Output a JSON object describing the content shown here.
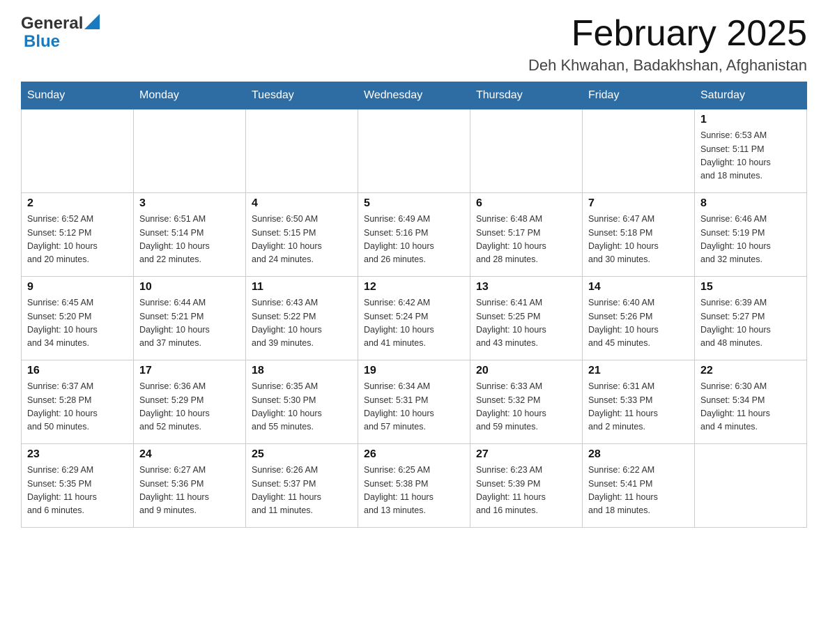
{
  "header": {
    "logo_general": "General",
    "logo_blue": "Blue",
    "month_title": "February 2025",
    "location": "Deh Khwahan, Badakhshan, Afghanistan"
  },
  "weekdays": [
    "Sunday",
    "Monday",
    "Tuesday",
    "Wednesday",
    "Thursday",
    "Friday",
    "Saturday"
  ],
  "weeks": [
    [
      {
        "day": "",
        "info": ""
      },
      {
        "day": "",
        "info": ""
      },
      {
        "day": "",
        "info": ""
      },
      {
        "day": "",
        "info": ""
      },
      {
        "day": "",
        "info": ""
      },
      {
        "day": "",
        "info": ""
      },
      {
        "day": "1",
        "info": "Sunrise: 6:53 AM\nSunset: 5:11 PM\nDaylight: 10 hours\nand 18 minutes."
      }
    ],
    [
      {
        "day": "2",
        "info": "Sunrise: 6:52 AM\nSunset: 5:12 PM\nDaylight: 10 hours\nand 20 minutes."
      },
      {
        "day": "3",
        "info": "Sunrise: 6:51 AM\nSunset: 5:14 PM\nDaylight: 10 hours\nand 22 minutes."
      },
      {
        "day": "4",
        "info": "Sunrise: 6:50 AM\nSunset: 5:15 PM\nDaylight: 10 hours\nand 24 minutes."
      },
      {
        "day": "5",
        "info": "Sunrise: 6:49 AM\nSunset: 5:16 PM\nDaylight: 10 hours\nand 26 minutes."
      },
      {
        "day": "6",
        "info": "Sunrise: 6:48 AM\nSunset: 5:17 PM\nDaylight: 10 hours\nand 28 minutes."
      },
      {
        "day": "7",
        "info": "Sunrise: 6:47 AM\nSunset: 5:18 PM\nDaylight: 10 hours\nand 30 minutes."
      },
      {
        "day": "8",
        "info": "Sunrise: 6:46 AM\nSunset: 5:19 PM\nDaylight: 10 hours\nand 32 minutes."
      }
    ],
    [
      {
        "day": "9",
        "info": "Sunrise: 6:45 AM\nSunset: 5:20 PM\nDaylight: 10 hours\nand 34 minutes."
      },
      {
        "day": "10",
        "info": "Sunrise: 6:44 AM\nSunset: 5:21 PM\nDaylight: 10 hours\nand 37 minutes."
      },
      {
        "day": "11",
        "info": "Sunrise: 6:43 AM\nSunset: 5:22 PM\nDaylight: 10 hours\nand 39 minutes."
      },
      {
        "day": "12",
        "info": "Sunrise: 6:42 AM\nSunset: 5:24 PM\nDaylight: 10 hours\nand 41 minutes."
      },
      {
        "day": "13",
        "info": "Sunrise: 6:41 AM\nSunset: 5:25 PM\nDaylight: 10 hours\nand 43 minutes."
      },
      {
        "day": "14",
        "info": "Sunrise: 6:40 AM\nSunset: 5:26 PM\nDaylight: 10 hours\nand 45 minutes."
      },
      {
        "day": "15",
        "info": "Sunrise: 6:39 AM\nSunset: 5:27 PM\nDaylight: 10 hours\nand 48 minutes."
      }
    ],
    [
      {
        "day": "16",
        "info": "Sunrise: 6:37 AM\nSunset: 5:28 PM\nDaylight: 10 hours\nand 50 minutes."
      },
      {
        "day": "17",
        "info": "Sunrise: 6:36 AM\nSunset: 5:29 PM\nDaylight: 10 hours\nand 52 minutes."
      },
      {
        "day": "18",
        "info": "Sunrise: 6:35 AM\nSunset: 5:30 PM\nDaylight: 10 hours\nand 55 minutes."
      },
      {
        "day": "19",
        "info": "Sunrise: 6:34 AM\nSunset: 5:31 PM\nDaylight: 10 hours\nand 57 minutes."
      },
      {
        "day": "20",
        "info": "Sunrise: 6:33 AM\nSunset: 5:32 PM\nDaylight: 10 hours\nand 59 minutes."
      },
      {
        "day": "21",
        "info": "Sunrise: 6:31 AM\nSunset: 5:33 PM\nDaylight: 11 hours\nand 2 minutes."
      },
      {
        "day": "22",
        "info": "Sunrise: 6:30 AM\nSunset: 5:34 PM\nDaylight: 11 hours\nand 4 minutes."
      }
    ],
    [
      {
        "day": "23",
        "info": "Sunrise: 6:29 AM\nSunset: 5:35 PM\nDaylight: 11 hours\nand 6 minutes."
      },
      {
        "day": "24",
        "info": "Sunrise: 6:27 AM\nSunset: 5:36 PM\nDaylight: 11 hours\nand 9 minutes."
      },
      {
        "day": "25",
        "info": "Sunrise: 6:26 AM\nSunset: 5:37 PM\nDaylight: 11 hours\nand 11 minutes."
      },
      {
        "day": "26",
        "info": "Sunrise: 6:25 AM\nSunset: 5:38 PM\nDaylight: 11 hours\nand 13 minutes."
      },
      {
        "day": "27",
        "info": "Sunrise: 6:23 AM\nSunset: 5:39 PM\nDaylight: 11 hours\nand 16 minutes."
      },
      {
        "day": "28",
        "info": "Sunrise: 6:22 AM\nSunset: 5:41 PM\nDaylight: 11 hours\nand 18 minutes."
      },
      {
        "day": "",
        "info": ""
      }
    ]
  ]
}
